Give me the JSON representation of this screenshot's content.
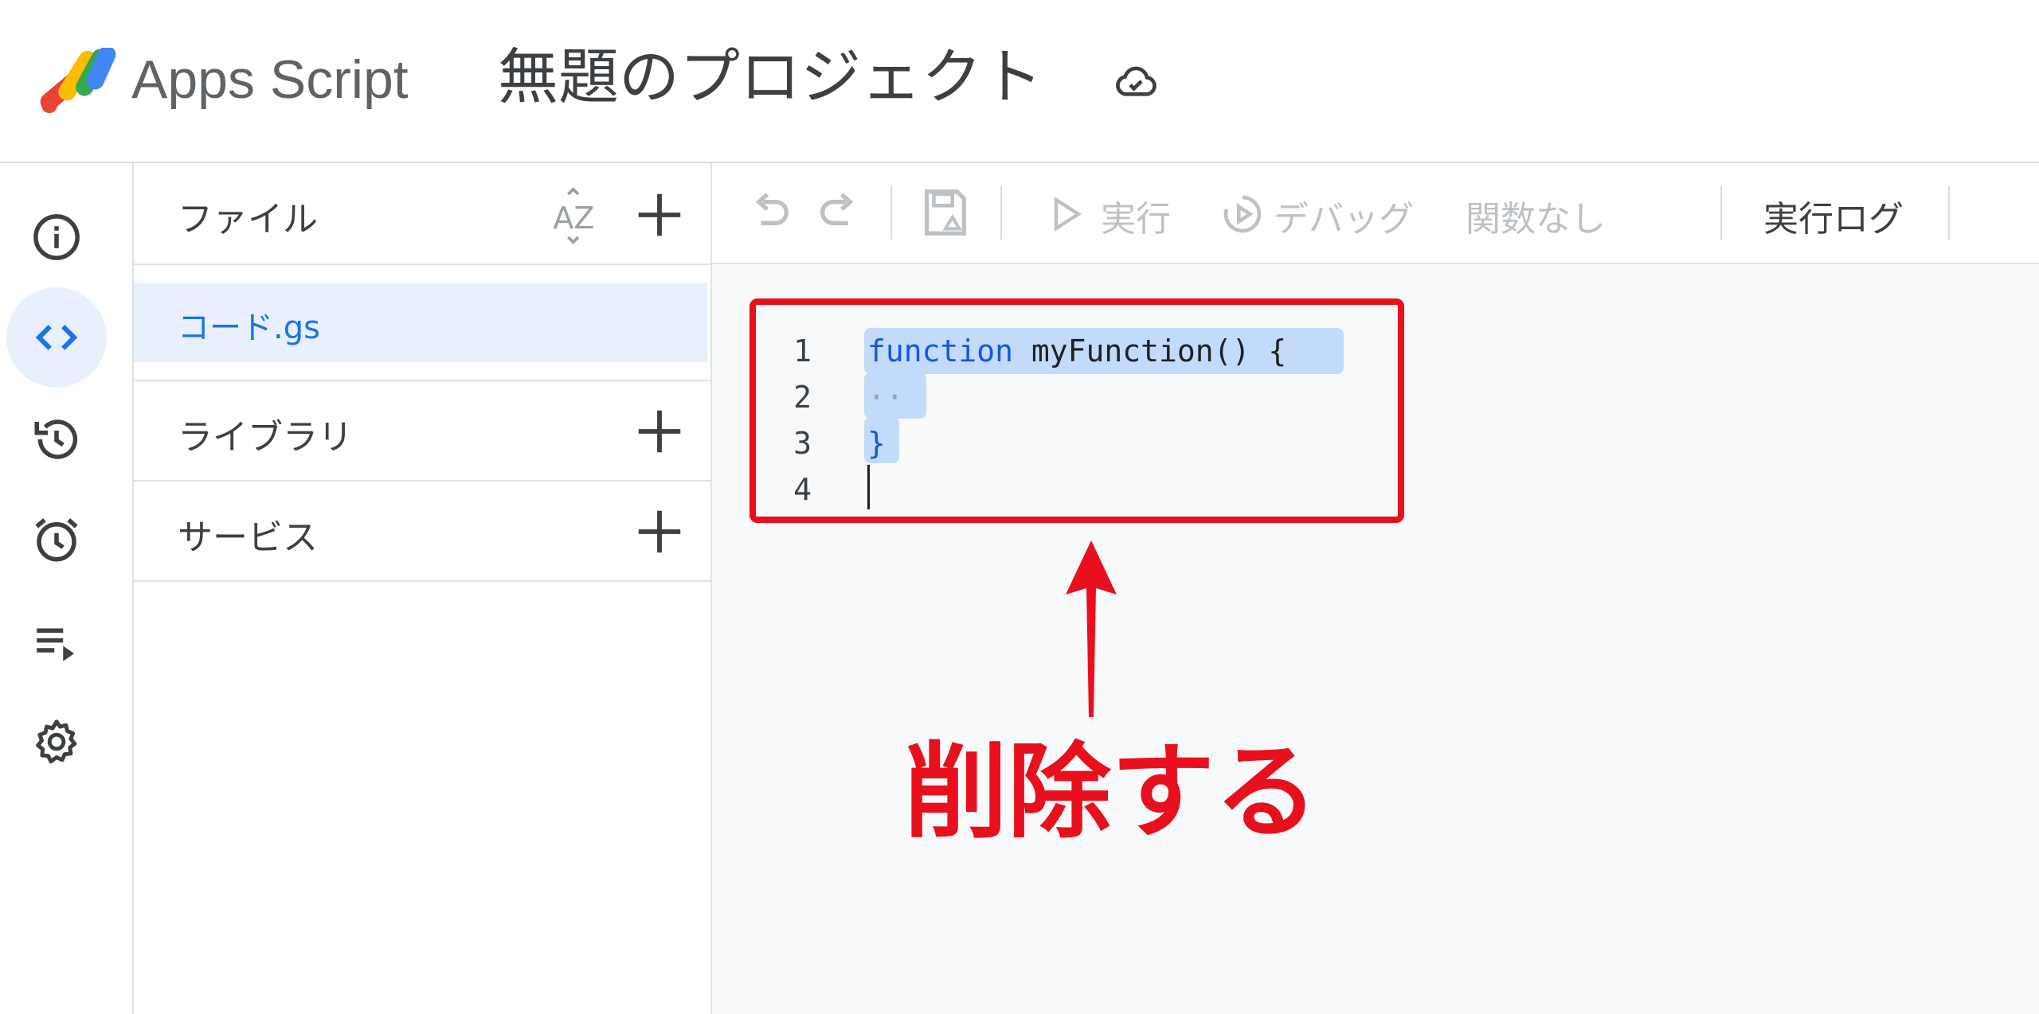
{
  "header": {
    "app_name": "Apps Script",
    "project_title": "無題のプロジェクト"
  },
  "rail": {
    "items": [
      {
        "icon": "info-icon"
      },
      {
        "icon": "code-icon",
        "active": true
      },
      {
        "icon": "history-icon"
      },
      {
        "icon": "alarm-icon"
      },
      {
        "icon": "executions-icon"
      },
      {
        "icon": "gear-icon"
      }
    ]
  },
  "files_panel": {
    "files_label": "ファイル",
    "file_name": "コード.gs",
    "libraries_label": "ライブラリ",
    "services_label": "サービス"
  },
  "toolbar": {
    "run_label": "実行",
    "debug_label": "デバッグ",
    "function_select": "関数なし",
    "log_label": "実行ログ"
  },
  "editor": {
    "lines": [
      {
        "number": "1",
        "keyword": "function",
        "rest": " myFunction() {"
      },
      {
        "number": "2",
        "text": "··"
      },
      {
        "number": "3",
        "text": "}"
      },
      {
        "number": "4",
        "text": ""
      }
    ]
  },
  "annotation": {
    "text": "削除する",
    "color": "#e8101d"
  },
  "colors": {
    "accent": "#1a73e8",
    "selection": "#c2dbfb",
    "active_bg": "#e8f0fe"
  }
}
